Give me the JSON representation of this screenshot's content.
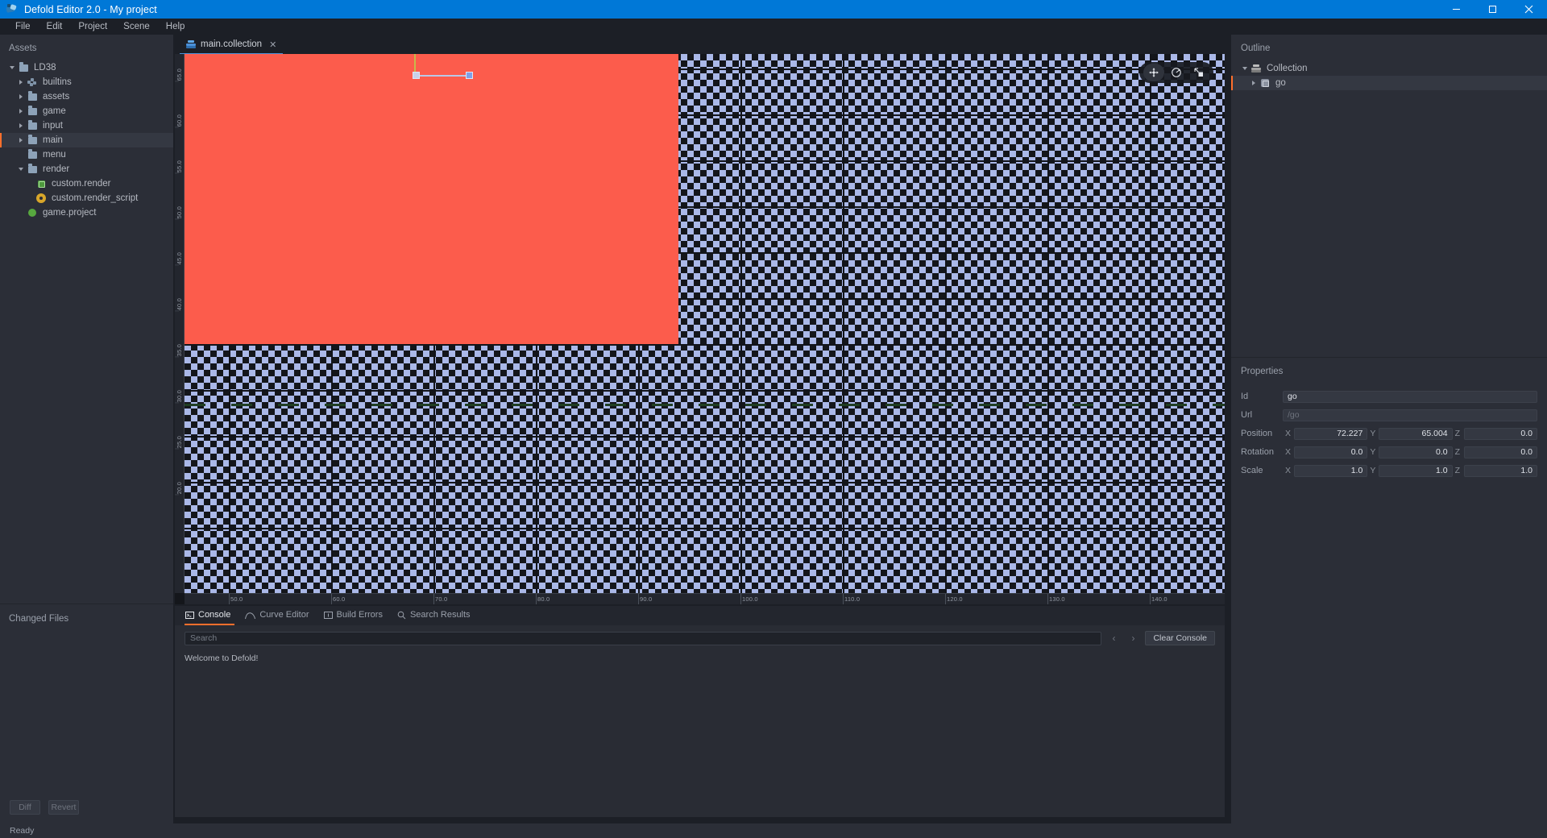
{
  "window": {
    "title": "Defold Editor 2.0 - My project",
    "logo_icon": "defold-logo-icon",
    "minimize_icon": "minimize-icon",
    "maximize_icon": "maximize-icon",
    "close_icon": "close-icon"
  },
  "menubar": {
    "items": [
      {
        "label": "File"
      },
      {
        "label": "Edit"
      },
      {
        "label": "Project"
      },
      {
        "label": "Scene"
      },
      {
        "label": "Help"
      }
    ]
  },
  "assets": {
    "header": "Assets",
    "tree": [
      {
        "label": "LD38",
        "depth": 0,
        "icon": "folder-icon",
        "twisty": "open",
        "selected": false
      },
      {
        "label": "builtins",
        "depth": 1,
        "icon": "builtins-icon",
        "twisty": "closed",
        "selected": false
      },
      {
        "label": "assets",
        "depth": 1,
        "icon": "folder-icon",
        "twisty": "closed",
        "selected": false
      },
      {
        "label": "game",
        "depth": 1,
        "icon": "folder-icon",
        "twisty": "closed",
        "selected": false
      },
      {
        "label": "input",
        "depth": 1,
        "icon": "folder-icon",
        "twisty": "closed",
        "selected": false
      },
      {
        "label": "main",
        "depth": 1,
        "icon": "folder-icon",
        "twisty": "closed",
        "selected": true
      },
      {
        "label": "menu",
        "depth": 1,
        "icon": "folder-icon",
        "twisty": "none",
        "selected": false
      },
      {
        "label": "render",
        "depth": 1,
        "icon": "folder-icon",
        "twisty": "open",
        "selected": false
      },
      {
        "label": "custom.render",
        "depth": 2,
        "icon": "render-file-icon",
        "twisty": "none",
        "selected": false
      },
      {
        "label": "custom.render_script",
        "depth": 2,
        "icon": "script-gear-icon",
        "twisty": "none",
        "selected": false
      },
      {
        "label": "game.project",
        "depth": 1,
        "icon": "project-dot-icon",
        "twisty": "none",
        "selected": false
      }
    ]
  },
  "changed_files": {
    "header": "Changed Files",
    "diff_label": "Diff",
    "revert_label": "Revert"
  },
  "editor": {
    "tab": {
      "label": "main.collection",
      "icon": "collection-icon",
      "close_icon": "close-icon"
    }
  },
  "viewport": {
    "vertical_ruler_ticks": [
      "65.0",
      "60.0",
      "55.0",
      "50.0",
      "45.0",
      "40.0",
      "35.0",
      "30.0",
      "25.0",
      "20.0"
    ],
    "horizontal_ruler_ticks": [
      "50.0",
      "60.0",
      "70.0",
      "80.0",
      "90.0",
      "100.0",
      "110.0",
      "120.0",
      "130.0",
      "140.0"
    ],
    "tools": [
      {
        "name": "move-tool",
        "icon": "move-icon",
        "active": true
      },
      {
        "name": "rotate-tool",
        "icon": "rotate-icon",
        "active": false
      },
      {
        "name": "scale-tool",
        "icon": "scale-icon",
        "active": false
      }
    ],
    "colors": {
      "planet": "#fc5c4c",
      "checker": "#aab8e8",
      "background": "#14161b"
    }
  },
  "console": {
    "tabs": [
      {
        "label": "Console",
        "icon": "console-icon",
        "active": true
      },
      {
        "label": "Curve Editor",
        "icon": "curve-icon",
        "active": false
      },
      {
        "label": "Build Errors",
        "icon": "build-errors-icon",
        "active": false
      },
      {
        "label": "Search Results",
        "icon": "search-icon",
        "active": false
      }
    ],
    "search_placeholder": "Search",
    "search_value": "",
    "prev_icon": "chevron-left-icon",
    "next_icon": "chevron-right-icon",
    "clear_label": "Clear Console",
    "output": "Welcome to Defold!"
  },
  "outline": {
    "header": "Outline",
    "items": [
      {
        "label": "Collection",
        "depth": 0,
        "icon": "collection-icon",
        "twisty": "open",
        "selected": false
      },
      {
        "label": "go",
        "depth": 1,
        "icon": "game-object-icon",
        "twisty": "closed",
        "selected": true
      }
    ]
  },
  "properties": {
    "header": "Properties",
    "id_label": "Id",
    "id_value": "go",
    "url_label": "Url",
    "url_placeholder": "/go",
    "position_label": "Position",
    "position": {
      "x": "72.227",
      "y": "65.004",
      "z": "0.0"
    },
    "rotation_label": "Rotation",
    "rotation": {
      "x": "0.0",
      "y": "0.0",
      "z": "0.0"
    },
    "scale_label": "Scale",
    "scale": {
      "x": "1.0",
      "y": "1.0",
      "z": "1.0"
    },
    "axis_x": "X",
    "axis_y": "Y",
    "axis_z": "Z"
  },
  "statusbar": {
    "text": "Ready"
  }
}
